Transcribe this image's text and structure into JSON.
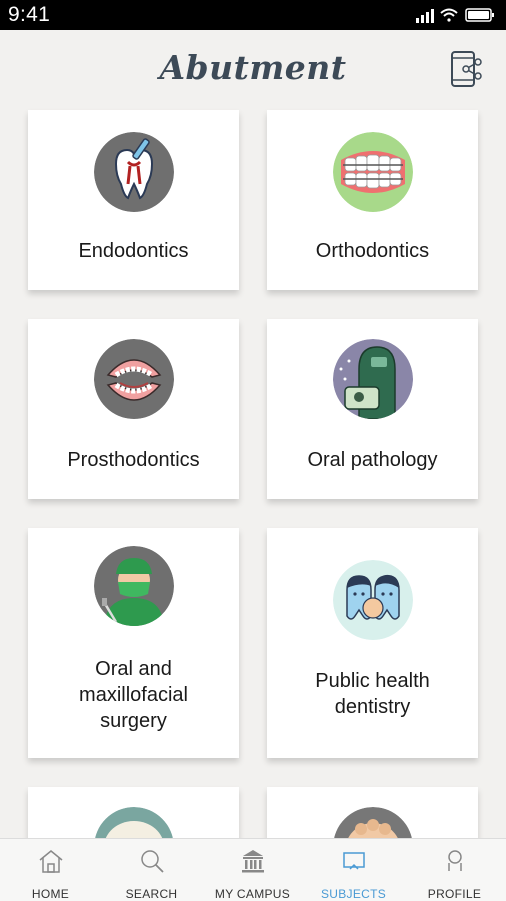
{
  "status": {
    "time": "9:41"
  },
  "header": {
    "title": "Abutment"
  },
  "subjects": [
    {
      "label": "Endodontics",
      "icon": "tooth-root-canal-icon"
    },
    {
      "label": "Orthodontics",
      "icon": "braces-icon"
    },
    {
      "label": "Prosthodontics",
      "icon": "dentures-icon"
    },
    {
      "label": "Oral pathology",
      "icon": "pathology-icon"
    },
    {
      "label": "Oral and maxillofacial surgery",
      "icon": "surgeon-icon"
    },
    {
      "label": "Public health dentistry",
      "icon": "family-teeth-icon"
    }
  ],
  "tabs": [
    {
      "label": "HOME",
      "icon": "home-icon"
    },
    {
      "label": "SEARCH",
      "icon": "search-icon"
    },
    {
      "label": "MY CAMPUS",
      "icon": "campus-icon"
    },
    {
      "label": "SUBJECTS",
      "icon": "subjects-icon",
      "active": true
    },
    {
      "label": "PROFILE",
      "icon": "profile-icon"
    }
  ],
  "colors": {
    "accent": "#4a9ad4",
    "background": "#f2f1ef",
    "title": "#3d4a57"
  }
}
